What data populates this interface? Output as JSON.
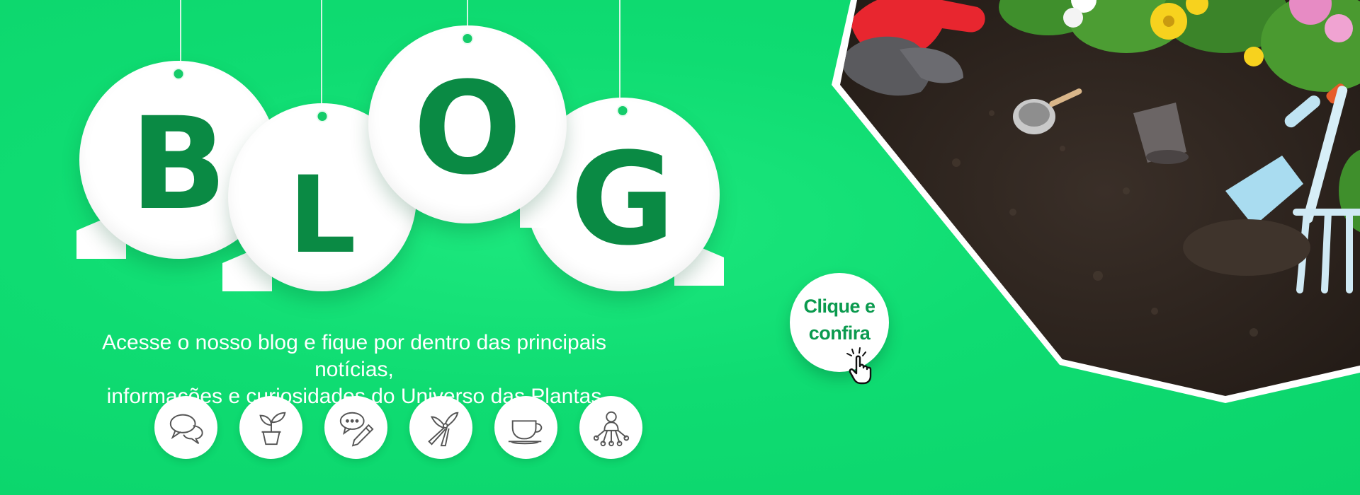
{
  "blog": {
    "letters": [
      "B",
      "L",
      "O",
      "G"
    ]
  },
  "tagline": {
    "line1": "Acesse o nosso blog e fique por dentro das principais notícias,",
    "line2": "informações e curiosidades do Universo das Plantas"
  },
  "cta": {
    "line1": "Clique e",
    "line2": "confira"
  },
  "icons": [
    "speech-bubbles-icon",
    "potted-plant-icon",
    "chat-pencil-icon",
    "pruning-shears-icon",
    "coffee-cup-icon",
    "network-user-icon"
  ],
  "colors": {
    "background": "#0fdc72",
    "letter": "#0a8a44",
    "icon_stroke": "#555555",
    "cta_text": "#0a9a4e",
    "soil": "#2e2520"
  }
}
